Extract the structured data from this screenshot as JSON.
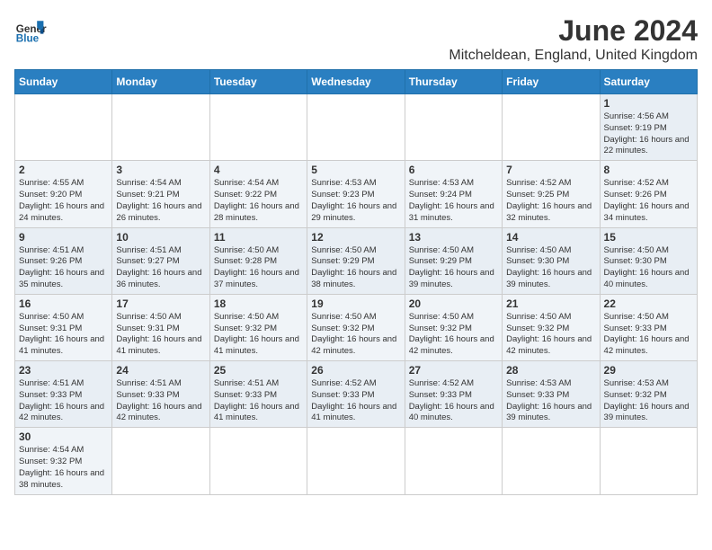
{
  "header": {
    "logo_general": "General",
    "logo_blue": "Blue",
    "month_year": "June 2024",
    "location": "Mitcheldean, England, United Kingdom"
  },
  "days_of_week": [
    "Sunday",
    "Monday",
    "Tuesday",
    "Wednesday",
    "Thursday",
    "Friday",
    "Saturday"
  ],
  "weeks": [
    [
      null,
      null,
      null,
      null,
      null,
      null,
      {
        "day": "1",
        "sunrise": "Sunrise: 4:56 AM",
        "sunset": "Sunset: 9:19 PM",
        "daylight": "Daylight: 16 hours and 22 minutes."
      }
    ],
    [
      {
        "day": "2",
        "sunrise": "Sunrise: 4:55 AM",
        "sunset": "Sunset: 9:20 PM",
        "daylight": "Daylight: 16 hours and 24 minutes."
      },
      {
        "day": "3",
        "sunrise": "Sunrise: 4:54 AM",
        "sunset": "Sunset: 9:21 PM",
        "daylight": "Daylight: 16 hours and 26 minutes."
      },
      {
        "day": "4",
        "sunrise": "Sunrise: 4:54 AM",
        "sunset": "Sunset: 9:22 PM",
        "daylight": "Daylight: 16 hours and 28 minutes."
      },
      {
        "day": "5",
        "sunrise": "Sunrise: 4:53 AM",
        "sunset": "Sunset: 9:23 PM",
        "daylight": "Daylight: 16 hours and 29 minutes."
      },
      {
        "day": "6",
        "sunrise": "Sunrise: 4:53 AM",
        "sunset": "Sunset: 9:24 PM",
        "daylight": "Daylight: 16 hours and 31 minutes."
      },
      {
        "day": "7",
        "sunrise": "Sunrise: 4:52 AM",
        "sunset": "Sunset: 9:25 PM",
        "daylight": "Daylight: 16 hours and 32 minutes."
      },
      {
        "day": "8",
        "sunrise": "Sunrise: 4:52 AM",
        "sunset": "Sunset: 9:26 PM",
        "daylight": "Daylight: 16 hours and 34 minutes."
      }
    ],
    [
      {
        "day": "9",
        "sunrise": "Sunrise: 4:51 AM",
        "sunset": "Sunset: 9:26 PM",
        "daylight": "Daylight: 16 hours and 35 minutes."
      },
      {
        "day": "10",
        "sunrise": "Sunrise: 4:51 AM",
        "sunset": "Sunset: 9:27 PM",
        "daylight": "Daylight: 16 hours and 36 minutes."
      },
      {
        "day": "11",
        "sunrise": "Sunrise: 4:50 AM",
        "sunset": "Sunset: 9:28 PM",
        "daylight": "Daylight: 16 hours and 37 minutes."
      },
      {
        "day": "12",
        "sunrise": "Sunrise: 4:50 AM",
        "sunset": "Sunset: 9:29 PM",
        "daylight": "Daylight: 16 hours and 38 minutes."
      },
      {
        "day": "13",
        "sunrise": "Sunrise: 4:50 AM",
        "sunset": "Sunset: 9:29 PM",
        "daylight": "Daylight: 16 hours and 39 minutes."
      },
      {
        "day": "14",
        "sunrise": "Sunrise: 4:50 AM",
        "sunset": "Sunset: 9:30 PM",
        "daylight": "Daylight: 16 hours and 39 minutes."
      },
      {
        "day": "15",
        "sunrise": "Sunrise: 4:50 AM",
        "sunset": "Sunset: 9:30 PM",
        "daylight": "Daylight: 16 hours and 40 minutes."
      }
    ],
    [
      {
        "day": "16",
        "sunrise": "Sunrise: 4:50 AM",
        "sunset": "Sunset: 9:31 PM",
        "daylight": "Daylight: 16 hours and 41 minutes."
      },
      {
        "day": "17",
        "sunrise": "Sunrise: 4:50 AM",
        "sunset": "Sunset: 9:31 PM",
        "daylight": "Daylight: 16 hours and 41 minutes."
      },
      {
        "day": "18",
        "sunrise": "Sunrise: 4:50 AM",
        "sunset": "Sunset: 9:32 PM",
        "daylight": "Daylight: 16 hours and 41 minutes."
      },
      {
        "day": "19",
        "sunrise": "Sunrise: 4:50 AM",
        "sunset": "Sunset: 9:32 PM",
        "daylight": "Daylight: 16 hours and 42 minutes."
      },
      {
        "day": "20",
        "sunrise": "Sunrise: 4:50 AM",
        "sunset": "Sunset: 9:32 PM",
        "daylight": "Daylight: 16 hours and 42 minutes."
      },
      {
        "day": "21",
        "sunrise": "Sunrise: 4:50 AM",
        "sunset": "Sunset: 9:32 PM",
        "daylight": "Daylight: 16 hours and 42 minutes."
      },
      {
        "day": "22",
        "sunrise": "Sunrise: 4:50 AM",
        "sunset": "Sunset: 9:33 PM",
        "daylight": "Daylight: 16 hours and 42 minutes."
      }
    ],
    [
      {
        "day": "23",
        "sunrise": "Sunrise: 4:51 AM",
        "sunset": "Sunset: 9:33 PM",
        "daylight": "Daylight: 16 hours and 42 minutes."
      },
      {
        "day": "24",
        "sunrise": "Sunrise: 4:51 AM",
        "sunset": "Sunset: 9:33 PM",
        "daylight": "Daylight: 16 hours and 42 minutes."
      },
      {
        "day": "25",
        "sunrise": "Sunrise: 4:51 AM",
        "sunset": "Sunset: 9:33 PM",
        "daylight": "Daylight: 16 hours and 41 minutes."
      },
      {
        "day": "26",
        "sunrise": "Sunrise: 4:52 AM",
        "sunset": "Sunset: 9:33 PM",
        "daylight": "Daylight: 16 hours and 41 minutes."
      },
      {
        "day": "27",
        "sunrise": "Sunrise: 4:52 AM",
        "sunset": "Sunset: 9:33 PM",
        "daylight": "Daylight: 16 hours and 40 minutes."
      },
      {
        "day": "28",
        "sunrise": "Sunrise: 4:53 AM",
        "sunset": "Sunset: 9:33 PM",
        "daylight": "Daylight: 16 hours and 39 minutes."
      },
      {
        "day": "29",
        "sunrise": "Sunrise: 4:53 AM",
        "sunset": "Sunset: 9:32 PM",
        "daylight": "Daylight: 16 hours and 39 minutes."
      }
    ],
    [
      {
        "day": "30",
        "sunrise": "Sunrise: 4:54 AM",
        "sunset": "Sunset: 9:32 PM",
        "daylight": "Daylight: 16 hours and 38 minutes."
      },
      null,
      null,
      null,
      null,
      null,
      null
    ]
  ]
}
